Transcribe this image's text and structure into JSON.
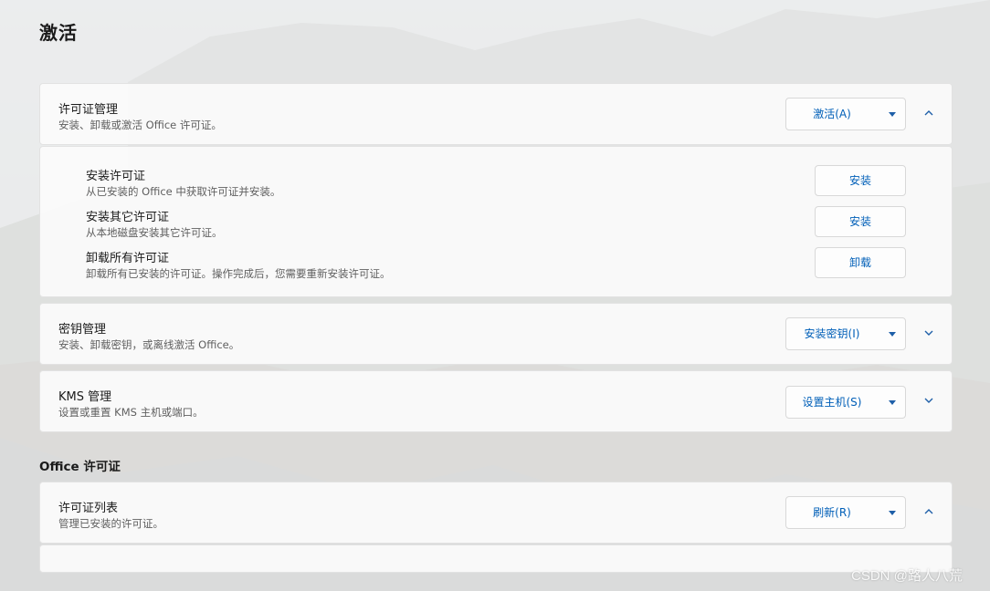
{
  "page": {
    "title": "激活"
  },
  "license_mgmt": {
    "title": "许可证管理",
    "desc": "安装、卸载或激活 Office 许可证。",
    "action_label": "激活(A)",
    "expanded": true,
    "items": [
      {
        "title": "安装许可证",
        "desc": "从已安装的 Office 中获取许可证并安装。",
        "button": "安装"
      },
      {
        "title": "安装其它许可证",
        "desc": "从本地磁盘安装其它许可证。",
        "button": "安装"
      },
      {
        "title": "卸载所有许可证",
        "desc": "卸载所有已安装的许可证。操作完成后，您需要重新安装许可证。",
        "button": "卸载"
      }
    ]
  },
  "key_mgmt": {
    "title": "密钥管理",
    "desc": "安装、卸载密钥，或离线激活 Office。",
    "action_label": "安装密钥(I)",
    "expanded": false
  },
  "kms_mgmt": {
    "title": "KMS 管理",
    "desc": "设置或重置 KMS 主机或端口。",
    "action_label": "设置主机(S)",
    "expanded": false
  },
  "office_license": {
    "section_title": "Office 许可证",
    "list": {
      "title": "许可证列表",
      "desc": "管理已安装的许可证。",
      "action_label": "刷新(R)",
      "expanded": true
    }
  },
  "watermark": "CSDN @路人八荒",
  "colors": {
    "accent": "#005fb8",
    "card_bg": "#fafafa",
    "border": "#e2e2e2"
  },
  "icons": {
    "dropdown": "caret-down-icon",
    "expand": "chevron-down-icon",
    "collapse": "chevron-up-icon"
  }
}
